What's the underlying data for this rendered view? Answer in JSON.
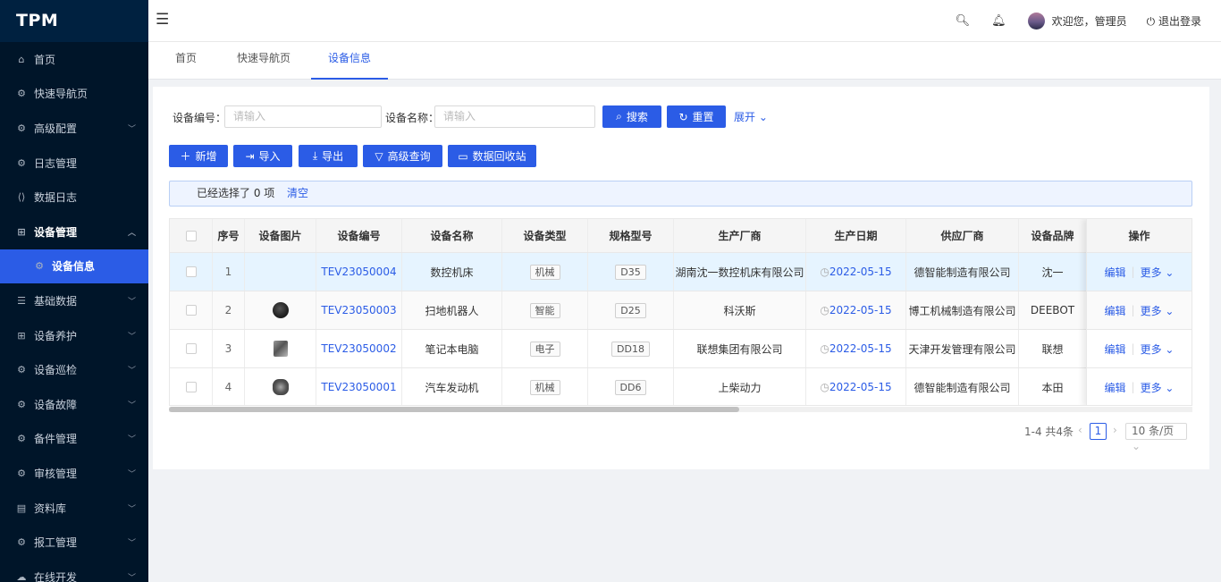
{
  "app": {
    "logo": "TPM"
  },
  "sidebar": {
    "items": [
      {
        "label": "首页",
        "icon": "home-icon"
      },
      {
        "label": "快速导航页",
        "icon": "gear-icon"
      },
      {
        "label": "高级配置",
        "icon": "gear-icon",
        "has_arrow": true
      },
      {
        "label": "日志管理",
        "icon": "gear-icon"
      },
      {
        "label": "数据日志",
        "icon": "code-icon"
      },
      {
        "label": "设备管理",
        "icon": "grid-icon",
        "has_arrow": true,
        "open": true
      },
      {
        "label": "设备信息",
        "icon": "gear-icon",
        "sub": true,
        "active": true
      },
      {
        "label": "基础数据",
        "icon": "form-icon",
        "has_arrow": true
      },
      {
        "label": "设备养护",
        "icon": "grid-icon",
        "has_arrow": true
      },
      {
        "label": "设备巡检",
        "icon": "gear-icon",
        "has_arrow": true
      },
      {
        "label": "设备故障",
        "icon": "gear-icon",
        "has_arrow": true
      },
      {
        "label": "备件管理",
        "icon": "gear-icon",
        "has_arrow": true
      },
      {
        "label": "审核管理",
        "icon": "gear-icon",
        "has_arrow": true
      },
      {
        "label": "资料库",
        "icon": "file-icon",
        "has_arrow": true
      },
      {
        "label": "报工管理",
        "icon": "gear-icon",
        "has_arrow": true
      },
      {
        "label": "在线开发",
        "icon": "cloud-icon",
        "has_arrow": true
      }
    ]
  },
  "header": {
    "welcome": "欢迎您，管理员",
    "logout": "退出登录"
  },
  "tabs": [
    "首页",
    "快速导航页",
    "设备信息"
  ],
  "search": {
    "code_label": "设备编号：",
    "code_placeholder": "请输入",
    "name_label": "设备名称：",
    "name_placeholder": "请输入",
    "search_btn": "搜索",
    "reset_btn": "重置",
    "expand": "展开"
  },
  "toolbar": {
    "add": "新增",
    "import": "导入",
    "export": "导出",
    "advanced": "高级查询",
    "recycle": "数据回收站"
  },
  "selection": {
    "text": "已经选择了 0 项",
    "clear": "清空"
  },
  "table": {
    "headers": [
      "序号",
      "设备图片",
      "设备编号",
      "设备名称",
      "设备类型",
      "规格型号",
      "生产厂商",
      "生产日期",
      "供应厂商",
      "设备品牌",
      "操作"
    ],
    "rows": [
      {
        "no": "1",
        "image": "",
        "code": "TEV23050004",
        "name": "数控机床",
        "type": "机械",
        "spec": "D35",
        "maker": "湖南沈一数控机床有限公司",
        "date": "2022-05-15",
        "supplier": "德智能制造有限公司",
        "brand": "沈一"
      },
      {
        "no": "2",
        "image": "robot-vacuum",
        "code": "TEV23050003",
        "name": "扫地机器人",
        "type": "智能",
        "spec": "D25",
        "maker": "科沃斯",
        "date": "2022-05-15",
        "supplier": "博工机械制造有限公司",
        "brand": "DEEBOT"
      },
      {
        "no": "3",
        "image": "laptop",
        "code": "TEV23050002",
        "name": "笔记本电脑",
        "type": "电子",
        "spec": "DD18",
        "maker": "联想集团有限公司",
        "date": "2022-05-15",
        "supplier": "天津开发管理有限公司",
        "brand": "联想"
      },
      {
        "no": "4",
        "image": "engine",
        "code": "TEV23050001",
        "name": "汽车发动机",
        "type": "机械",
        "spec": "DD6",
        "maker": "上柴动力",
        "date": "2022-05-15",
        "supplier": "德智能制造有限公司",
        "brand": "本田"
      }
    ],
    "op_edit": "编辑",
    "op_more": "更多"
  },
  "pagination": {
    "total": "1-4 共4条",
    "current": "1",
    "page_size": "10 条/页"
  },
  "colors": {
    "primary": "#2b5ce6",
    "sidebar_bg": "#001529",
    "row_highlight": "#e6f4ff"
  }
}
